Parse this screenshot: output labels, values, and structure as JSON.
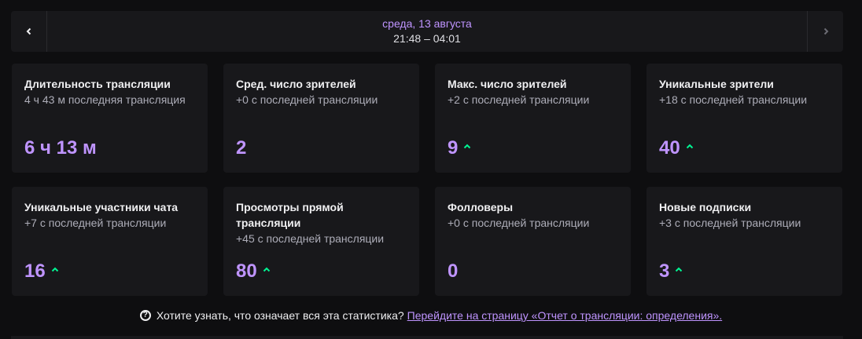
{
  "date_nav": {
    "date": "среда, 13 августа",
    "time_range": "21:48 – 04:01"
  },
  "cards": [
    {
      "title": "Длительность трансляции",
      "subtitle": "4 ч 43 м последняя трансляция",
      "value": "6 ч 13 м",
      "trend": "none"
    },
    {
      "title": "Сред. число зрителей",
      "subtitle": "+0 с последней трансляции",
      "value": "2",
      "trend": "none"
    },
    {
      "title": "Макс. число зрителей",
      "subtitle": "+2 с последней трансляции",
      "value": "9",
      "trend": "up"
    },
    {
      "title": "Уникальные зрители",
      "subtitle": "+18 с последней трансляции",
      "value": "40",
      "trend": "up"
    },
    {
      "title": "Уникальные участники чата",
      "subtitle": "+7 с последней трансляции",
      "value": "16",
      "trend": "up"
    },
    {
      "title": "Просмотры прямой трансляции",
      "subtitle": "+45 с последней трансляции",
      "value": "80",
      "trend": "up"
    },
    {
      "title": "Фолловеры",
      "subtitle": "+0 с последней трансляции",
      "value": "0",
      "trend": "none"
    },
    {
      "title": "Новые подписки",
      "subtitle": "+3 с последней трансляции",
      "value": "3",
      "trend": "up"
    }
  ],
  "footer": {
    "question": "Хотите узнать, что означает вся эта статистика?",
    "link": "Перейдите на страницу «Отчет о трансляции: определения»."
  },
  "colors": {
    "accent": "#bf94ff",
    "trend_up": "#00f593"
  }
}
